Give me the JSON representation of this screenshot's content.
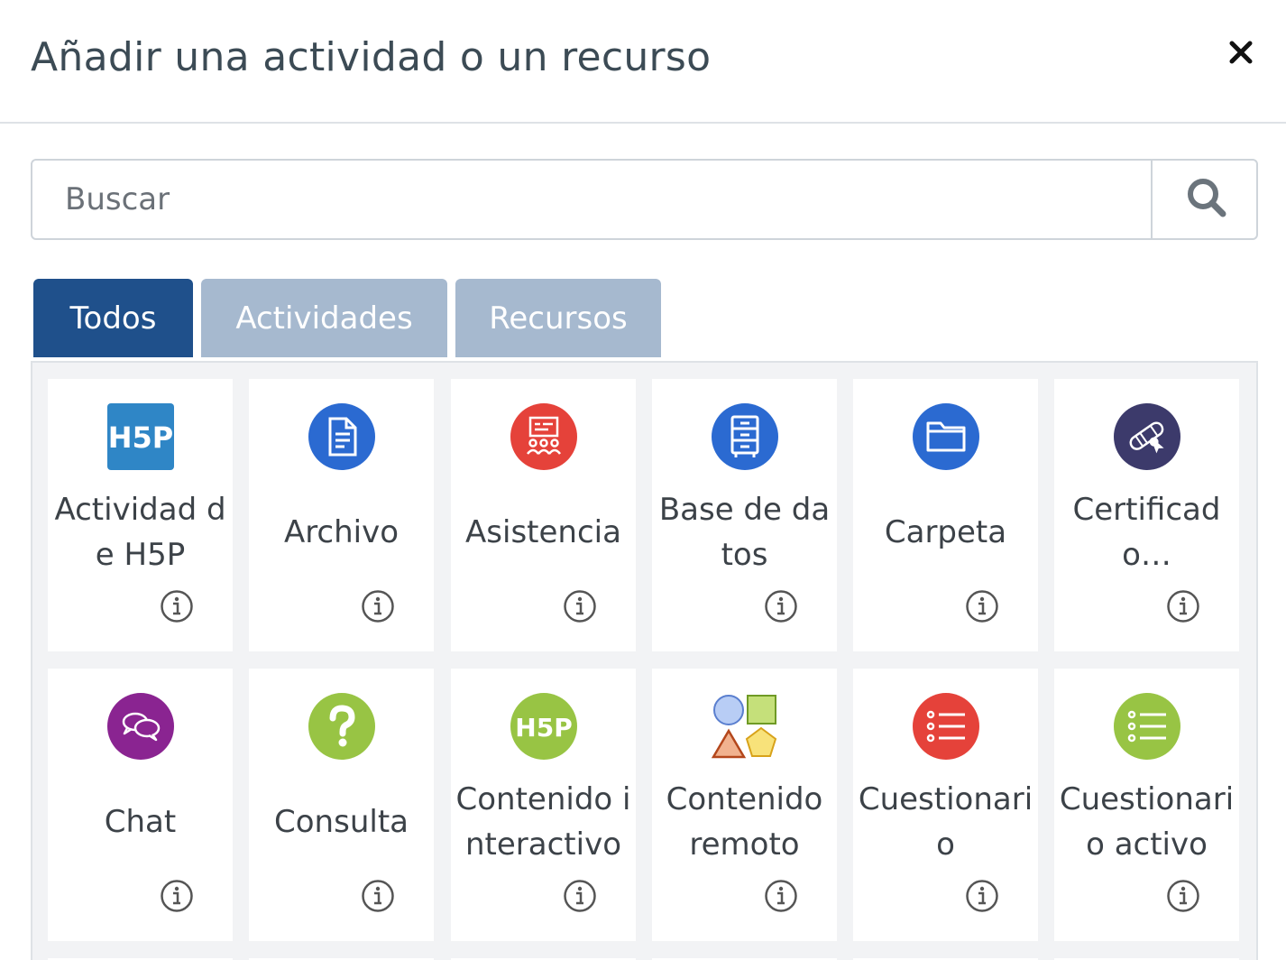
{
  "header": {
    "title": "Añadir una actividad o un recurso",
    "close_icon": "close-icon"
  },
  "search": {
    "placeholder": "Buscar",
    "value": "",
    "icon": "search-icon"
  },
  "tabs": [
    {
      "label": "Todos",
      "active": true
    },
    {
      "label": "Actividades",
      "active": false
    },
    {
      "label": "Recursos",
      "active": false
    }
  ],
  "modules": [
    {
      "label": "Actividad de H5P",
      "icon": "h5p-icon"
    },
    {
      "label": "Archivo",
      "icon": "file-icon"
    },
    {
      "label": "Asistencia",
      "icon": "attendance-icon"
    },
    {
      "label": "Base de datos",
      "icon": "database-icon"
    },
    {
      "label": "Carpeta",
      "icon": "folder-icon"
    },
    {
      "label": "Certificado…",
      "icon": "certificate-icon"
    },
    {
      "label": "Chat",
      "icon": "chat-icon"
    },
    {
      "label": "Consulta",
      "icon": "question-icon"
    },
    {
      "label": "Contenido interactivo",
      "icon": "h5p-interactive-icon"
    },
    {
      "label": "Contenido remoto",
      "icon": "shapes-icon"
    },
    {
      "label": "Cuestionario",
      "icon": "quiz-icon"
    },
    {
      "label": "Cuestionario activo",
      "icon": "active-quiz-icon"
    }
  ],
  "colors": {
    "tab_active": "#1f508b",
    "tab_inactive": "#a6b9cf",
    "blue_icon": "#2b6ad1",
    "red_icon": "#e5423a",
    "purple_icon": "#8a2491",
    "green_icon": "#98c444",
    "navy_icon": "#3c3a6b",
    "h5p_blue": "#2f86c6"
  }
}
